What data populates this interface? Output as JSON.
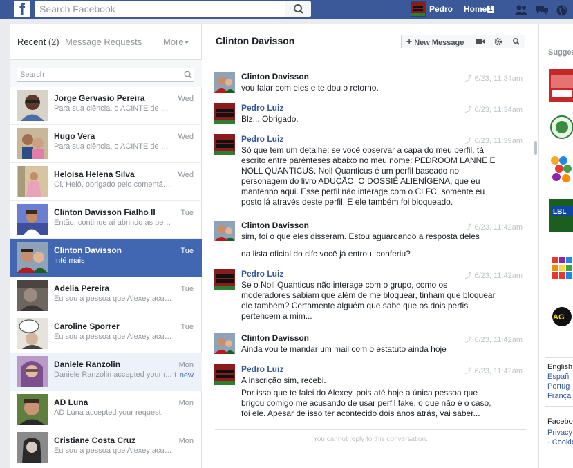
{
  "topbar": {
    "logo": "f",
    "search_placeholder": "Search Facebook",
    "user_name": "Pedro",
    "home_label": "Home",
    "home_count": "1",
    "icons": [
      "friend-requests-icon",
      "messages-icon",
      "notifications-globe-icon"
    ]
  },
  "inbox": {
    "tab_recent": "Recent",
    "tab_recent_count": "(2)",
    "tab_requests": "Message Requests",
    "tab_more": "More",
    "search_placeholder": "Search",
    "conversations": [
      {
        "name": "Jorge Gervasio Pereira",
        "snippet": "Para sua ciência, o ACINTE de Cl...",
        "time": "Wed",
        "state": "read"
      },
      {
        "name": "Hugo Vera",
        "snippet": "Para sua ciência, o ACINTE de Cl...",
        "time": "Wed",
        "state": "read"
      },
      {
        "name": "Heloisa Helena Silva",
        "snippet": "Oi, Helô, obrigado pelo comentári...",
        "time": "Wed",
        "state": "read"
      },
      {
        "name": "Clinton Davisson Fialho II",
        "snippet": "Então, continue aí abrindo as pern...",
        "time": "Tue",
        "state": "read"
      },
      {
        "name": "Clinton Davisson",
        "snippet": "Inté mais",
        "time": "Tue",
        "state": "active"
      },
      {
        "name": "Adelia Pereira",
        "snippet": "Eu sou a pessoa que Alexey acus...",
        "time": "Tue",
        "state": "read"
      },
      {
        "name": "Caroline Sporrer",
        "snippet": "Eu sou a pessoa que Alexey acus...",
        "time": "Tue",
        "state": "read"
      },
      {
        "name": "Daniele Ranzolin",
        "snippet": "Daniele Ranzolin accepted your r...",
        "time": "Mon",
        "new": "1 new",
        "state": "unread"
      },
      {
        "name": "AD Luna",
        "snippet": "AD Luna accepted your request.",
        "time": "Mon",
        "state": "read"
      },
      {
        "name": "Cristiane Costa Cruz",
        "snippet": "Eu sou a pessoa que Alexey acus...",
        "time": "Mon",
        "state": "read"
      }
    ]
  },
  "chat": {
    "title": "Clinton Davisson",
    "new_message_label": "New Message",
    "messages": [
      {
        "author": "Clinton Davisson",
        "me": false,
        "time": "6/23, 11:34am",
        "text": "vou falar com eles e te dou o retorno."
      },
      {
        "author": "Pedro Luiz",
        "me": true,
        "time": "6/23, 11:34am",
        "text": "Blz... Obrigado."
      },
      {
        "author": "Pedro Luiz",
        "me": true,
        "time": "6/23, 11:39am",
        "text": "Só que tem um detalhe: se você observar a capa do meu perfil, tá escrito entre parênteses abaixo no meu nome: PEDROOM LANNE E NOLL QUANTICUS. Noll Quanticus é um perfil baseado no personagem do livro ADUÇÃO, O DOSSIÊ ALIENÍGENA, que eu mantenho aqui. Esse perfil não interage com o CLFC, somente eu posto lá através deste perfil. E ele também foi bloqueado."
      },
      {
        "author": "Clinton Davisson",
        "me": false,
        "time": "6/23, 11:42am",
        "text": "sim, foi o que eles disseram. Estou aguardando a resposta deles",
        "text2": "na lista oficial do clfc  você já entrou, conferiu?"
      },
      {
        "author": "Pedro Luiz",
        "me": true,
        "time": "6/23, 11:42am",
        "text": "Se o Noll Quanticus não interage com o grupo, como os moderadores sabiam que além de me bloquear, tinham que bloquear ele também? Certamente alguém que sabe que os dois perfis pertencem a mim..."
      },
      {
        "author": "Clinton Davisson",
        "me": false,
        "time": "6/23, 11:42am",
        "text": "Ainda vou te mandar um mail com o estatuto ainda hoje"
      },
      {
        "author": "Pedro Luiz",
        "me": true,
        "time": "6/23, 11:42am",
        "text": "A inscrição sim, recebi.",
        "text2": "Por isso que te falei do Alexey, pois até hoje a única pessoa que brigou comigo me acusando de usar perfil fake, o que não é o caso, foi ele. Apesar de isso ter acontecido dois anos atrás, vai saber..."
      }
    ],
    "reply_note": "You cannot reply to this conversation."
  },
  "sidebar": {
    "suggest_label": "Sugges",
    "languages": [
      "English",
      "Españ",
      "Portug",
      "França"
    ],
    "footer_brand": "Faceboo",
    "footer_privacy": "Privacy",
    "footer_cookies": "· Cookie"
  },
  "colors": {
    "brand": "#3b5998",
    "active_row": "#4267b2",
    "link": "#365899"
  }
}
